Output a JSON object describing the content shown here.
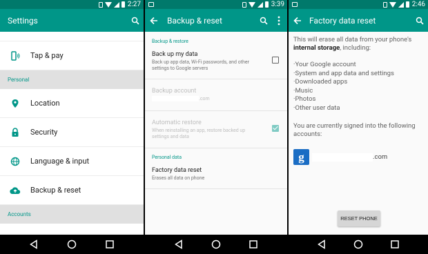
{
  "panels": {
    "settings": {
      "status_time": "2:27",
      "title": "Settings",
      "items": [
        {
          "label": "Tap & pay",
          "icon": "tap-pay-icon"
        },
        {
          "label": "Location",
          "icon": "location-icon"
        },
        {
          "label": "Security",
          "icon": "lock-icon"
        },
        {
          "label": "Language & input",
          "icon": "globe-icon"
        },
        {
          "label": "Backup & reset",
          "icon": "cloud-upload-icon"
        }
      ],
      "sections": {
        "personal": "Personal",
        "accounts": "Accounts"
      }
    },
    "backup": {
      "status_time": "3:39",
      "title": "Backup & reset",
      "cat_backup": "Backup & restore",
      "backup_title": "Back up my data",
      "backup_summary": "Back up app data, Wi-Fi passwords, and other settings to Google servers",
      "backup_checked": false,
      "account_title": "Backup account",
      "account_suffix": ".com",
      "restore_title": "Automatic restore",
      "restore_summary": "When reinstalling an app, restore backed up settings and data",
      "restore_checked": true,
      "cat_personal": "Personal data",
      "factory_title": "Factory data reset",
      "factory_summary": "Erases all data on phone"
    },
    "factory": {
      "status_time": "2:46",
      "title": "Factory data reset",
      "intro_prefix": "This will erase all data from your phone's",
      "intro_bold": "internal storage",
      "intro_suffix": ", including:",
      "bullets": [
        "·Your Google account",
        "·System and app data and settings",
        "·Downloaded apps",
        "·Music",
        "·Photos",
        "·Other user data"
      ],
      "signed_in": "You are currently signed into the following accounts:",
      "account_suffix": ".com",
      "reset_button": "RESET PHONE"
    }
  },
  "colors": {
    "primary": "#009688",
    "status_bar": "#00796b",
    "section_bg": "#e0e0e0",
    "google_blue": "#1a6dc4"
  }
}
